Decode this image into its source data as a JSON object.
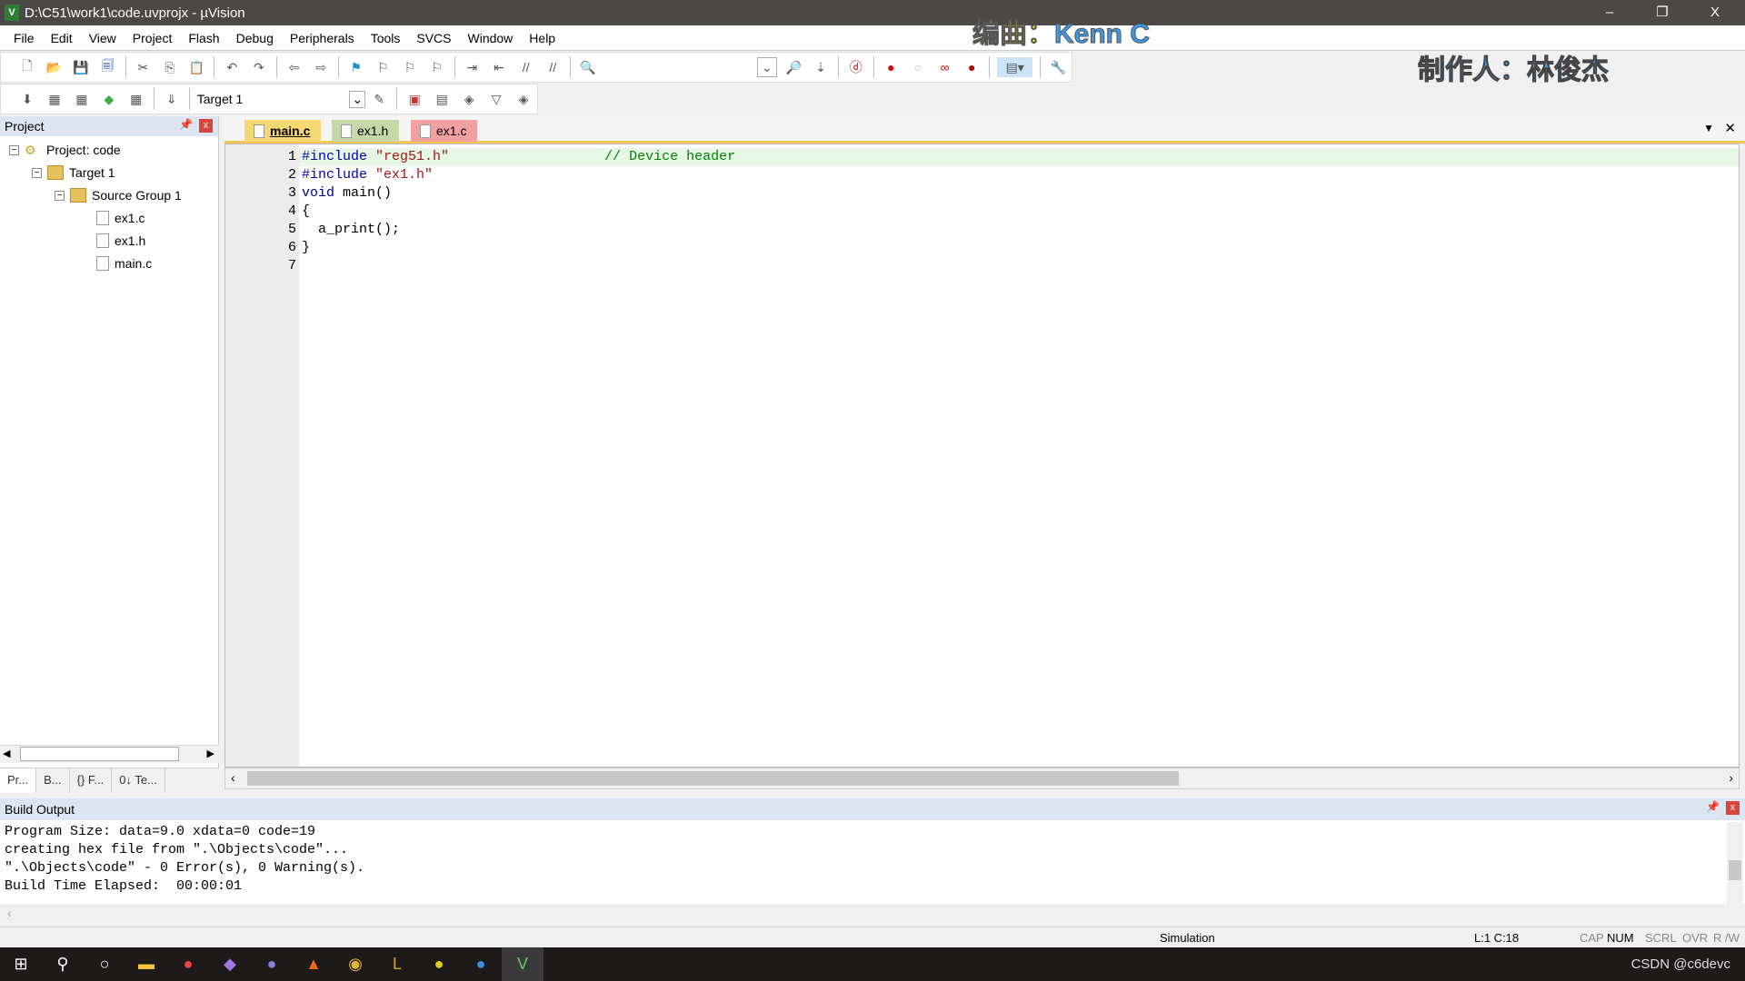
{
  "window": {
    "title": "D:\\C51\\work1\\code.uvprojx - µVision",
    "minimize": "–",
    "restore": "❐",
    "close": "X"
  },
  "overlay": {
    "composer_label": "编曲：",
    "composer": "Kenn C",
    "maker": "制作人：林俊杰"
  },
  "menu": [
    "File",
    "Edit",
    "View",
    "Project",
    "Flash",
    "Debug",
    "Peripherals",
    "Tools",
    "SVCS",
    "Window",
    "Help"
  ],
  "toolbar2": {
    "target": "Target 1"
  },
  "project": {
    "title": "Project",
    "root": "Project: code",
    "target": "Target 1",
    "group": "Source Group 1",
    "files": [
      "ex1.c",
      "ex1.h",
      "main.c"
    ],
    "tabs": [
      "Pr...",
      "B...",
      "{} F...",
      "0↓ Te..."
    ]
  },
  "editor": {
    "tabs": [
      {
        "label": "main.c",
        "color": "#f7d774"
      },
      {
        "label": "ex1.h",
        "color": "#c5d9a8"
      },
      {
        "label": "ex1.c",
        "color": "#f0a0a0"
      }
    ],
    "lines": [
      "1",
      "2",
      "3",
      "4",
      "5",
      "6",
      "7"
    ]
  },
  "build": {
    "title": "Build Output",
    "lines": [
      "Program Size: data=9.0 xdata=0 code=19",
      "creating hex file from \".\\Objects\\code\"...",
      "\".\\Objects\\code\" - 0 Error(s), 0 Warning(s).",
      "Build Time Elapsed:  00:00:01"
    ]
  },
  "status": {
    "mode": "Simulation",
    "pos": "L:1 C:18",
    "cap": "CAP",
    "num": "NUM",
    "scrl": "SCRL",
    "ovr": "OVR",
    "rw": "R /W"
  },
  "taskbar": {
    "tray_text": "CSDN @c6devc"
  }
}
